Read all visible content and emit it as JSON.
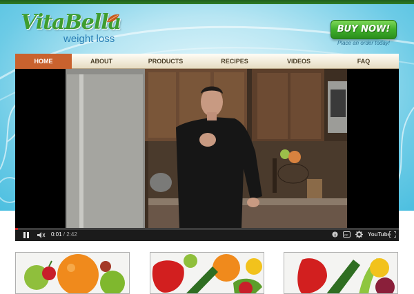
{
  "brand": {
    "name": "VitaBella",
    "tagline": "weight loss"
  },
  "cta": {
    "label": "BUY NOW!",
    "note": "Place an order today!"
  },
  "nav": {
    "items": [
      {
        "label": "HOME",
        "active": true
      },
      {
        "label": "ABOUT",
        "active": false
      },
      {
        "label": "PRODUCTS",
        "active": false
      },
      {
        "label": "RECIPES",
        "active": false
      },
      {
        "label": "VIDEOS",
        "active": false
      },
      {
        "label": "FAQ",
        "active": false
      }
    ]
  },
  "player": {
    "current_time": "0:01",
    "separator": " / ",
    "duration": "2:42",
    "progress": 0.006,
    "logo": "YouTube",
    "icons": [
      "pause-icon",
      "volume-icon",
      "info-icon",
      "captions-icon",
      "settings-icon",
      "youtube-logo",
      "fullscreen-icon"
    ]
  },
  "thumbnails": [
    {
      "name": "fruit-photo"
    },
    {
      "name": "vegetables-photo"
    },
    {
      "name": "produce-photo"
    }
  ],
  "colors": {
    "accent_green": "#3f9d2f",
    "nav_active": "#c9622e",
    "sky": "#6ccbe6",
    "progress": "#cc1f1f"
  }
}
